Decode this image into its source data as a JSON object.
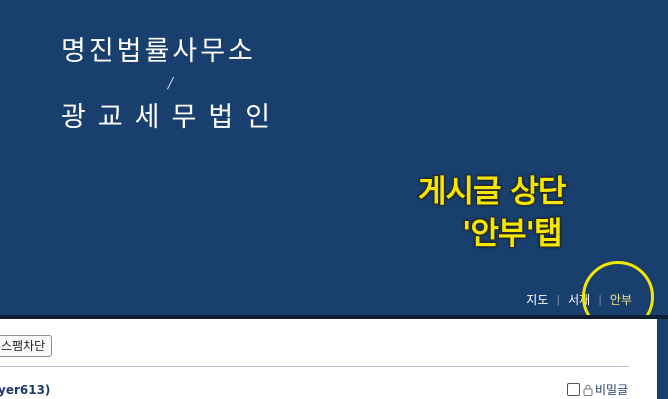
{
  "header": {
    "firm_name_1": "명진법률사무소",
    "separator": "/",
    "firm_name_2": "광교세무법인"
  },
  "annotation": {
    "line1": "게시글 상단",
    "line2": "'안부'탭"
  },
  "top_nav": {
    "items": [
      {
        "label": "지도"
      },
      {
        "label": "서재"
      },
      {
        "label": "안부"
      }
    ],
    "separator": "|",
    "active": "안부"
  },
  "post": {
    "spam_block_label": "스팸차단",
    "author_id_fragment": "yer613)",
    "secret_label": "비밀글"
  },
  "colors": {
    "header_bg": "#183f6d",
    "annotation": "#f4e600",
    "active_tab": "#f2e48a"
  }
}
